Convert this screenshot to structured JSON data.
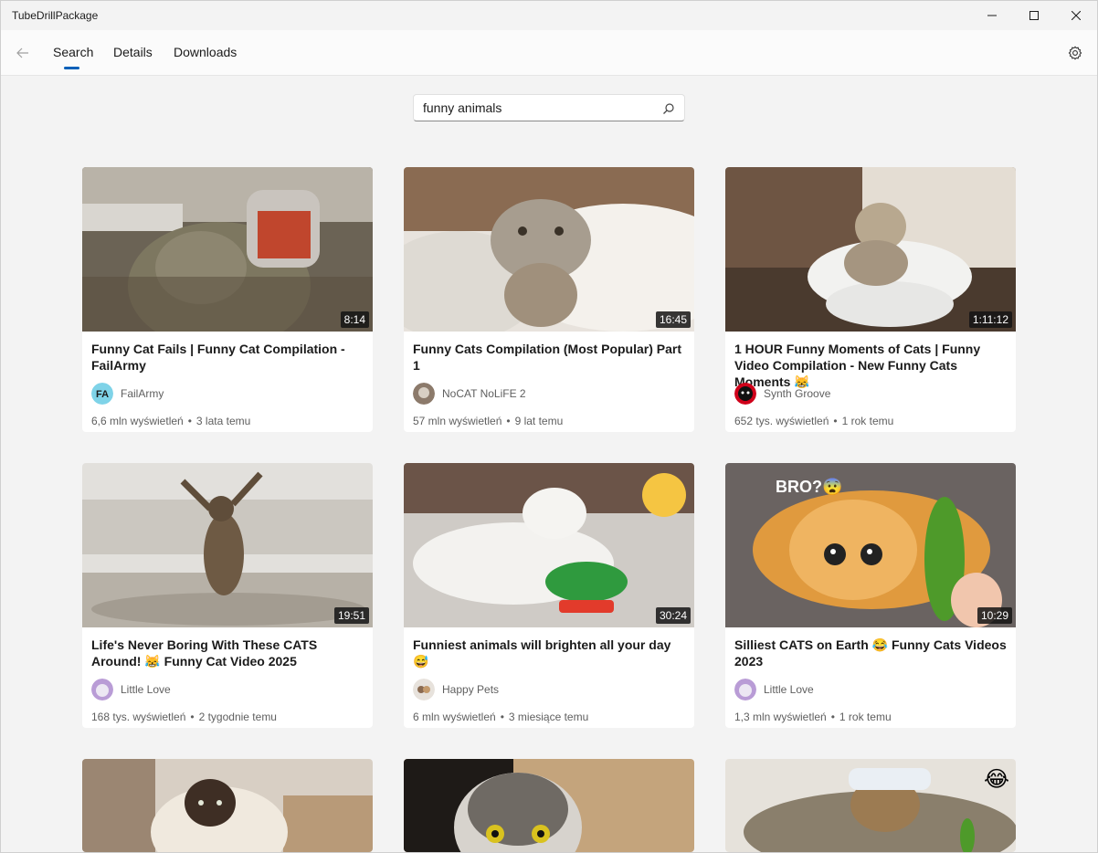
{
  "window": {
    "title": "TubeDrillPackage"
  },
  "nav": {
    "tabs": [
      {
        "label": "Search",
        "active": true
      },
      {
        "label": "Details",
        "active": false
      },
      {
        "label": "Downloads",
        "active": false
      }
    ],
    "back_icon": "arrow-left-icon",
    "settings_icon": "gear-icon"
  },
  "search": {
    "value": "funny animals",
    "icon": "search-icon"
  },
  "colors": {
    "accent": "#005fb8",
    "card_bg": "#ffffff",
    "page_bg": "#f3f3f3"
  },
  "videos": [
    {
      "title": "Funny Cat Fails | Funny Cat Compilation - FailArmy",
      "duration": "8:14",
      "channel": "FailArmy",
      "views": "6,6 mln wyświetleń",
      "age": "3 lata temu"
    },
    {
      "title": "Funny Cats Compilation (Most Popular) Part 1",
      "duration": "16:45",
      "channel": "NoCAT NoLiFE 2",
      "views": "57 mln wyświetleń",
      "age": "9 lat temu"
    },
    {
      "title": "1 HOUR Funny Moments of Cats | Funny Video Compilation - New Funny Cats Moments 😹",
      "duration": "1:11:12",
      "channel": "Synth Groove",
      "views": "652 tys. wyświetleń",
      "age": "1 rok temu"
    },
    {
      "title": "Life's Never Boring With These CATS Around! 😹 Funny Cat Video 2025",
      "duration": "19:51",
      "channel": "Little Love",
      "views": "168 tys. wyświetleń",
      "age": "2 tygodnie temu"
    },
    {
      "title": "Funniest animals will brighten all your day 😅",
      "duration": "30:24",
      "channel": "Happy Pets",
      "views": "6 mln wyświetleń",
      "age": "3 miesiące temu"
    },
    {
      "title": "Silliest CATS on Earth 😂   Funny Cats Videos 2023",
      "duration": "10:29",
      "channel": "Little Love",
      "views": "1,3 mln wyświetleń",
      "age": "1 rok temu"
    },
    {
      "title": "",
      "duration": "",
      "channel": "",
      "views": "",
      "age": ""
    },
    {
      "title": "",
      "duration": "",
      "channel": "",
      "views": "",
      "age": ""
    },
    {
      "title": "",
      "duration": "",
      "channel": "",
      "views": "",
      "age": ""
    }
  ],
  "thumb_overlays": {
    "v6": "BRO?😨",
    "v9": "😂"
  }
}
